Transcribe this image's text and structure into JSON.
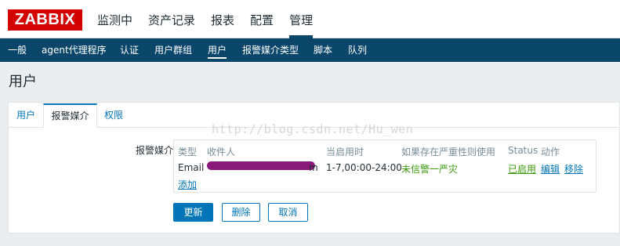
{
  "header": {
    "logo": "ZABBIX",
    "menu": [
      {
        "label": "监测中"
      },
      {
        "label": "资产记录"
      },
      {
        "label": "报表"
      },
      {
        "label": "配置"
      },
      {
        "label": "管理"
      }
    ]
  },
  "subnav": {
    "items": [
      {
        "label": "一般"
      },
      {
        "label": "agent代理程序"
      },
      {
        "label": "认证"
      },
      {
        "label": "用户群组"
      },
      {
        "label": "用户"
      },
      {
        "label": "报警媒介类型"
      },
      {
        "label": "脚本"
      },
      {
        "label": "队列"
      }
    ]
  },
  "page": {
    "title": "用户"
  },
  "tabs": [
    {
      "label": "用户"
    },
    {
      "label": "报警媒介"
    },
    {
      "label": "权限"
    }
  ],
  "media": {
    "field_label": "报警媒介",
    "headers": {
      "type": "类型",
      "recipient": "收件人",
      "when_active": "当启用时",
      "severity": "如果存在严重性则使用",
      "status": "Status",
      "action": "动作"
    },
    "row": {
      "type": "Email",
      "recipient_suffix": "m",
      "when_active": "1-7,00:00-24:00",
      "severity": "未信警一严灾",
      "status": "已启用",
      "edit": "编辑",
      "remove": "移除"
    },
    "add_label": "添加"
  },
  "buttons": {
    "update": "更新",
    "delete": "删除",
    "cancel": "取消"
  },
  "watermark": "http://blog.csdn.net/Hu_wen"
}
